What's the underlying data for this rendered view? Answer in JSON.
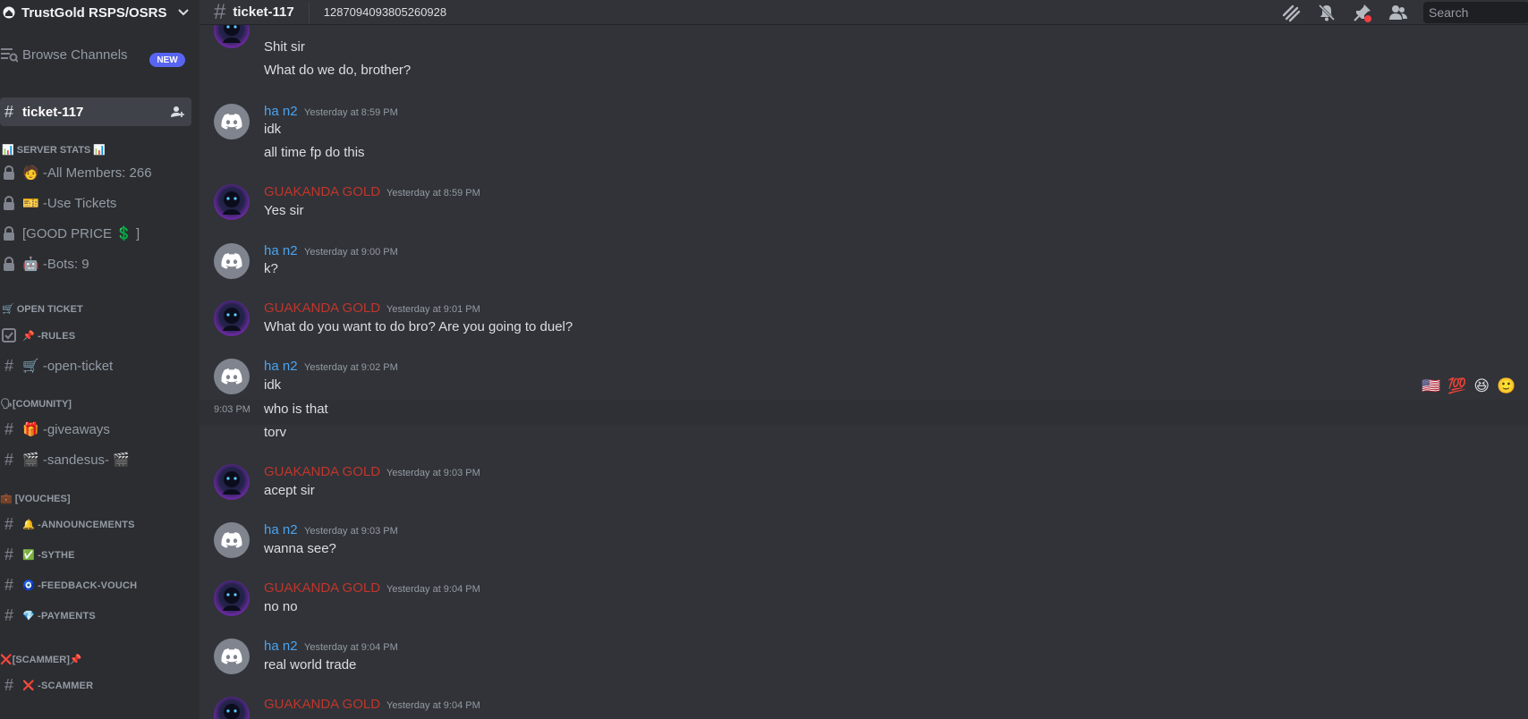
{
  "server": {
    "name": "TrustGold RSPS/OSRS"
  },
  "channel": {
    "name": "ticket-117",
    "id": "1287094093805260928"
  },
  "search": {
    "placeholder": "Search"
  },
  "sidebar": {
    "browse": {
      "label": "Browse Channels",
      "badge": "NEW"
    },
    "selected": {
      "label": "ticket-117"
    },
    "server_stats": {
      "category": "📊 SERVER STATS 📊",
      "items": [
        "🧑 -All Members: 266",
        "🎫 -Use Tickets",
        "[GOOD PRICE 💲 ]",
        "🤖 -Bots: 9"
      ]
    },
    "open_ticket": {
      "category": "🛒 OPEN TICKET",
      "items": [
        "📌 -RULES",
        "🛒 -open-ticket"
      ]
    },
    "community": {
      "category": "🗣[COMUNITY]",
      "items": [
        "🎁 -giveaways",
        "🎬 -sandesus- 🎬"
      ]
    },
    "vouches": {
      "category": "💼 [VOUCHES]",
      "items": [
        "🔔 -ANNOUNCEMENTS",
        "✅ -SYTHE",
        "🧿 -FEEDBACK-VOUCH",
        "💎 -PAYMENTS"
      ]
    },
    "scammer": {
      "category": "❌[SCAMMER]📌",
      "items": [
        "❌ -SCAMMER"
      ]
    }
  },
  "messages": [
    {
      "lines": [
        "Shit sir",
        "What do we do, brother?"
      ]
    },
    {
      "author": "ha n2",
      "time": "Yesterday at 8:59 PM",
      "lines": [
        "idk",
        "all time fp do this"
      ]
    },
    {
      "author": "GUAKANDA GOLD",
      "time": "Yesterday at 8:59 PM",
      "lines": [
        "Yes sir"
      ]
    },
    {
      "author": "ha n2",
      "time": "Yesterday at 9:00 PM",
      "lines": [
        "k?"
      ]
    },
    {
      "author": "GUAKANDA GOLD",
      "time": "Yesterday at 9:01 PM",
      "lines": [
        "What do you want to do bro? Are you going to duel?"
      ]
    },
    {
      "author": "ha n2",
      "time": "Yesterday at 9:02 PM",
      "lines": [
        "idk",
        "who is that",
        "torv"
      ],
      "side_time": "9:03 PM"
    },
    {
      "author": "GUAKANDA GOLD",
      "time": "Yesterday at 9:03 PM",
      "lines": [
        "acept sir"
      ]
    },
    {
      "author": "ha n2",
      "time": "Yesterday at 9:03 PM",
      "lines": [
        "wanna see?"
      ]
    },
    {
      "author": "GUAKANDA GOLD",
      "time": "Yesterday at 9:04 PM",
      "lines": [
        "no no"
      ]
    },
    {
      "author": "ha n2",
      "time": "Yesterday at 9:04 PM",
      "lines": [
        "real world trade"
      ]
    },
    {
      "author": "GUAKANDA GOLD",
      "time": "Yesterday at 9:04 PM",
      "lines": []
    }
  ],
  "reactions": [
    "🇺🇸",
    "💯",
    "😆",
    "🙂"
  ],
  "colors": {
    "hann2": "#4aa3f0",
    "guakanda": "#c1352b"
  }
}
